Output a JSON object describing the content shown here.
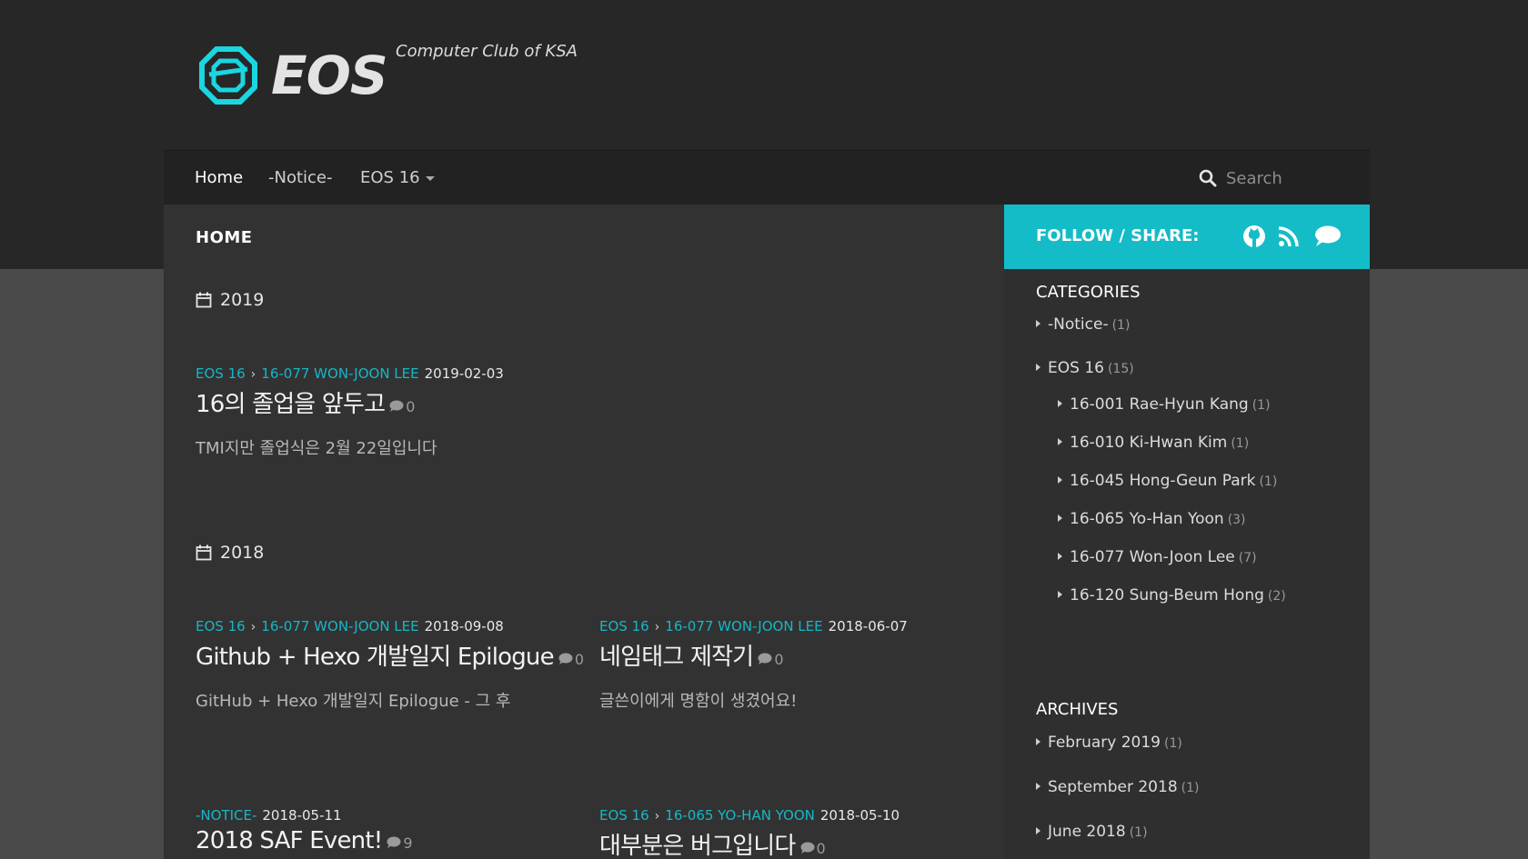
{
  "site": {
    "title": "EOS",
    "tagline": "Computer Club of KSA",
    "accent": "#16b7c7"
  },
  "nav": {
    "items": [
      {
        "label": "Home"
      },
      {
        "label": "-Notice-"
      },
      {
        "label": "EOS 16"
      }
    ],
    "search_placeholder": "Search"
  },
  "main": {
    "page_title": "HOME",
    "groups": [
      {
        "year": "2019"
      },
      {
        "year": "2018"
      }
    ],
    "posts": [
      {
        "category": "EOS 16",
        "subcategory": "16-077 WON-JOON LEE",
        "date": "2019-02-03",
        "title": "16의 졸업을 앞두고",
        "comments": "0",
        "excerpt": "TMI지만 졸업식은 2월 22일입니다"
      },
      {
        "category": "EOS 16",
        "subcategory": "16-077 WON-JOON LEE",
        "date": "2018-09-08",
        "title": "Github + Hexo 개발일지 Epilogue",
        "comments": "0",
        "excerpt": "GitHub + Hexo 개발일지 Epilogue - 그 후"
      },
      {
        "category": "EOS 16",
        "subcategory": "16-077 WON-JOON LEE",
        "date": "2018-06-07",
        "title": "네임태그 제작기",
        "comments": "0",
        "excerpt": "글쓴이에게 명함이 생겼어요!"
      },
      {
        "category": "-NOTICE-",
        "date": "2018-05-11",
        "title": "2018 SAF Event!",
        "comments": "9"
      },
      {
        "category": "EOS 16",
        "subcategory": "16-065 YO-HAN YOON",
        "date": "2018-05-10",
        "title": "대부분은 버그입니다",
        "comments": "0"
      }
    ]
  },
  "sidebar": {
    "follow_label": "FOLLOW / SHARE:",
    "follow_icons": [
      "github-icon",
      "rss-icon",
      "chat-icon"
    ],
    "categories_title": "CATEGORIES",
    "categories": [
      {
        "label": "-Notice-",
        "count": "(1)"
      },
      {
        "label": "EOS 16",
        "count": "(15)"
      },
      {
        "label": "16-001 Rae-Hyun Kang",
        "count": "(1)"
      },
      {
        "label": "16-010 Ki-Hwan Kim",
        "count": "(1)"
      },
      {
        "label": "16-045 Hong-Geun Park",
        "count": "(1)"
      },
      {
        "label": "16-065 Yo-Han Yoon",
        "count": "(3)"
      },
      {
        "label": "16-077 Won-Joon Lee",
        "count": "(7)"
      },
      {
        "label": "16-120 Sung-Beum Hong",
        "count": "(2)"
      }
    ],
    "archives_title": "ARCHIVES",
    "archives": [
      {
        "label": "February 2019",
        "count": "(1)"
      },
      {
        "label": "September 2018",
        "count": "(1)"
      },
      {
        "label": "June 2018",
        "count": "(1)"
      }
    ]
  }
}
